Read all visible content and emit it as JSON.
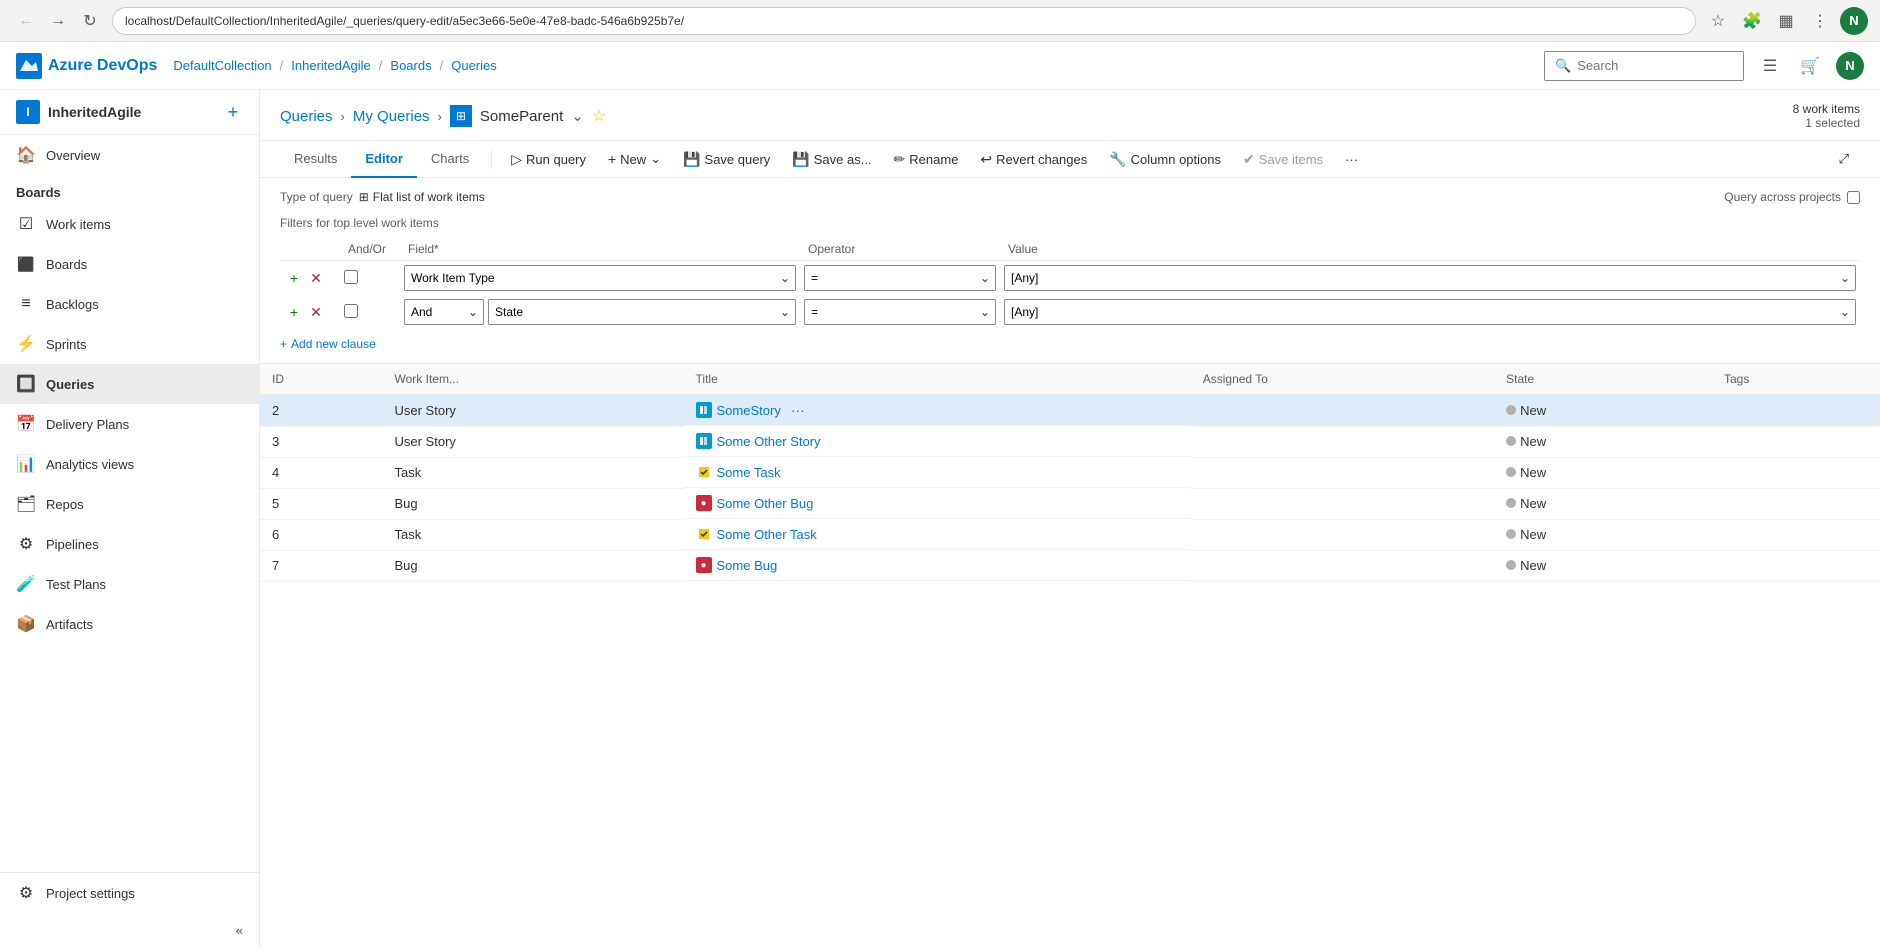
{
  "browser": {
    "url": "localhost/DefaultCollection/InheritedAgile/_queries/query-edit/a5ec3e66-5e0e-47e8-badc-546a6b925b7e/",
    "search_placeholder": "Search"
  },
  "top_nav": {
    "logo": "Azure DevOps",
    "breadcrumb": [
      "DefaultCollection",
      "/",
      "InheritedAgile",
      "/",
      "Boards",
      "/",
      "Queries"
    ]
  },
  "sidebar": {
    "org_name": "InheritedAgile",
    "org_initial": "I",
    "add_label": "+",
    "items": [
      {
        "id": "overview",
        "label": "Overview",
        "icon": "🏠"
      },
      {
        "id": "boards-header",
        "label": "Boards",
        "icon": ""
      },
      {
        "id": "work-items",
        "label": "Work items",
        "icon": "☑"
      },
      {
        "id": "boards",
        "label": "Boards",
        "icon": "⬛"
      },
      {
        "id": "backlogs",
        "label": "Backlogs",
        "icon": "≡"
      },
      {
        "id": "sprints",
        "label": "Sprints",
        "icon": "⚡"
      },
      {
        "id": "queries",
        "label": "Queries",
        "icon": "🔲",
        "active": true
      },
      {
        "id": "delivery-plans",
        "label": "Delivery Plans",
        "icon": "📅"
      },
      {
        "id": "analytics-views",
        "label": "Analytics views",
        "icon": "📊"
      },
      {
        "id": "repos",
        "label": "Repos",
        "icon": "🗂"
      },
      {
        "id": "pipelines",
        "label": "Pipelines",
        "icon": "⚙"
      },
      {
        "id": "test-plans",
        "label": "Test Plans",
        "icon": "🧪"
      },
      {
        "id": "artifacts",
        "label": "Artifacts",
        "icon": "📦"
      }
    ],
    "project_settings": "Project settings",
    "collapse_label": "«"
  },
  "page": {
    "breadcrumb_queries": "Queries",
    "breadcrumb_my_queries": "My Queries",
    "title": "SomeParent",
    "title_icon": "⊞",
    "work_items_count": "8 work items",
    "selected_count": "1 selected",
    "tabs": [
      "Results",
      "Editor",
      "Charts"
    ],
    "active_tab": "Editor"
  },
  "toolbar": {
    "run_query": "Run query",
    "new": "New",
    "save_query": "Save query",
    "save_as": "Save as...",
    "rename": "Rename",
    "revert_changes": "Revert changes",
    "column_options": "Column options",
    "save_items": "Save items",
    "more": "···"
  },
  "query_editor": {
    "type_label": "Type of query",
    "type_value": "Flat list of work items",
    "filters_label": "Filters for top level work items",
    "query_across_label": "Query across projects",
    "columns": {
      "and_or": "And/Or",
      "field": "Field*",
      "operator": "Operator",
      "value": "Value"
    },
    "rows": [
      {
        "and_or": "",
        "field": "Work Item Type",
        "operator": "=",
        "value": "[Any]"
      },
      {
        "and_or": "And",
        "field": "State",
        "operator": "=",
        "value": "[Any]"
      }
    ],
    "add_clause": "Add new clause"
  },
  "results": {
    "columns": [
      "ID",
      "Work Item...",
      "Title",
      "Assigned To",
      "State",
      "Tags"
    ],
    "rows": [
      {
        "id": "2",
        "type": "User Story",
        "type_icon": "story",
        "title": "SomeStory",
        "assigned_to": "",
        "state": "New",
        "tags": "",
        "selected": true,
        "has_more": true
      },
      {
        "id": "3",
        "type": "User Story",
        "type_icon": "story",
        "title": "Some Other Story",
        "assigned_to": "",
        "state": "New",
        "tags": "",
        "selected": false,
        "has_more": false
      },
      {
        "id": "4",
        "type": "Task",
        "type_icon": "task",
        "title": "Some Task",
        "assigned_to": "",
        "state": "New",
        "tags": "",
        "selected": false,
        "has_more": false
      },
      {
        "id": "5",
        "type": "Bug",
        "type_icon": "bug",
        "title": "Some Other Bug",
        "assigned_to": "",
        "state": "New",
        "tags": "",
        "selected": false,
        "has_more": false
      },
      {
        "id": "6",
        "type": "Task",
        "type_icon": "task",
        "title": "Some Other Task",
        "assigned_to": "",
        "state": "New",
        "tags": "",
        "selected": false,
        "has_more": false
      },
      {
        "id": "7",
        "type": "Bug",
        "type_icon": "bug",
        "title": "Some Bug",
        "assigned_to": "",
        "state": "New",
        "tags": "",
        "selected": false,
        "has_more": false
      }
    ]
  }
}
